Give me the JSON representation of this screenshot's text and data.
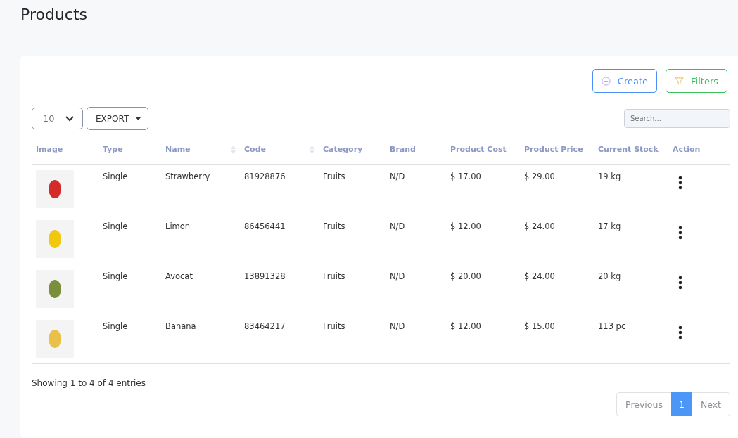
{
  "page": {
    "title": "Products"
  },
  "toolbar": {
    "buttons": [
      {
        "label": "Create",
        "kind": "create"
      },
      {
        "label": "Filters",
        "kind": "filter"
      }
    ]
  },
  "controls": {
    "page_size": "10",
    "export": "EXPORT",
    "search": {
      "placeholder": "Search..."
    }
  },
  "table": {
    "columns": [
      {
        "label": "Image",
        "sortable": false
      },
      {
        "label": "Type",
        "sortable": false
      },
      {
        "label": "Name",
        "sortable": true
      },
      {
        "label": "Code",
        "sortable": true
      },
      {
        "label": "Category",
        "sortable": false
      },
      {
        "label": "Brand",
        "sortable": false
      },
      {
        "label": "Product Cost",
        "sortable": false
      },
      {
        "label": "Product Price",
        "sortable": false
      },
      {
        "label": "Current Stock",
        "sortable": false
      },
      {
        "label": "Action",
        "sortable": false
      }
    ],
    "rows": [
      {
        "cells": [
          "",
          "Single",
          "Strawberry",
          "81928876",
          "Fruits",
          "N/D",
          "$ 17.00",
          "$ 29.00",
          "19 kg",
          ""
        ],
        "color": "#d42a2a"
      },
      {
        "cells": [
          "",
          "Single",
          "Limon",
          "86456441",
          "Fruits",
          "N/D",
          "$ 12.00",
          "$ 24.00",
          "17 kg",
          ""
        ],
        "color": "#f2c80f"
      },
      {
        "cells": [
          "",
          "Single",
          "Avocat",
          "13891328",
          "Fruits",
          "N/D",
          "$ 20.00",
          "$ 24.00",
          "20 kg",
          ""
        ],
        "color": "#7a8f3a"
      },
      {
        "cells": [
          "",
          "Single",
          "Banana",
          "83464217",
          "Fruits",
          "N/D",
          "$ 12.00",
          "$ 15.00",
          "113 pc",
          ""
        ],
        "color": "#e8c04a"
      }
    ]
  },
  "footer": {
    "summary": "Showing 1 to 4 of 4 entries",
    "pagination": [
      {
        "label": "Previous",
        "kind": "nav",
        "selected": false
      },
      {
        "label": "1",
        "kind": "page",
        "selected": true
      },
      {
        "label": "Next",
        "kind": "nav",
        "selected": false
      }
    ]
  }
}
